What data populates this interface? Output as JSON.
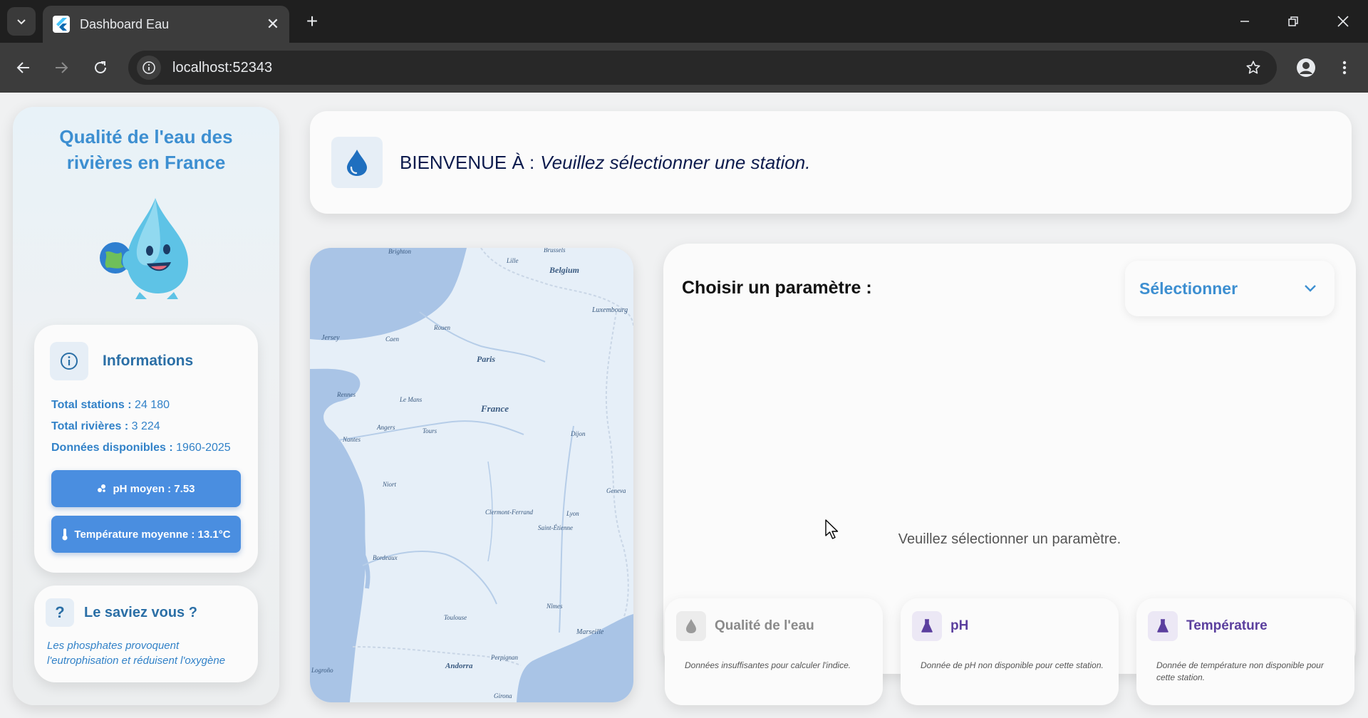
{
  "browser": {
    "tab_title": "Dashboard Eau",
    "url": "localhost:52343"
  },
  "sidebar": {
    "title": "Qualité de l'eau des rivières en France",
    "info": {
      "title": "Informations",
      "stats": [
        {
          "label": "Total stations :",
          "value": "24 180"
        },
        {
          "label": "Total rivières :",
          "value": "3 224"
        },
        {
          "label": "Données disponibles :",
          "value": "1960-2025"
        }
      ],
      "ph_button": "pH moyen : 7.53",
      "temp_button": "Température moyenne : 13.1°C"
    },
    "fact": {
      "title": "Le saviez vous ?",
      "text": "Les phosphates provoquent l'eutrophisation et réduisent l'oxygène"
    }
  },
  "banner": {
    "label": "BIENVENUE À :",
    "value": "Veuillez sélectionner une station."
  },
  "map": {
    "places": [
      {
        "name": "Brighton"
      },
      {
        "name": "Brussels"
      },
      {
        "name": "Lille"
      },
      {
        "name": "Belgium"
      },
      {
        "name": "Luxembourg"
      },
      {
        "name": "Jersey"
      },
      {
        "name": "Caen"
      },
      {
        "name": "Rouen"
      },
      {
        "name": "Paris"
      },
      {
        "name": "Rennes"
      },
      {
        "name": "Le Mans"
      },
      {
        "name": "France"
      },
      {
        "name": "Angers"
      },
      {
        "name": "Tours"
      },
      {
        "name": "Dijon"
      },
      {
        "name": "Nantes"
      },
      {
        "name": "Niort"
      },
      {
        "name": "Geneva"
      },
      {
        "name": "Clermont-Ferrand"
      },
      {
        "name": "Lyon"
      },
      {
        "name": "Saint-Étienne"
      },
      {
        "name": "Bordeaux"
      },
      {
        "name": "Nîmes"
      },
      {
        "name": "Toulouse"
      },
      {
        "name": "Marseille"
      },
      {
        "name": "Perpignan"
      },
      {
        "name": "Andorra"
      },
      {
        "name": "Logroño"
      },
      {
        "name": "Girona"
      }
    ]
  },
  "param_panel": {
    "label": "Choisir un paramètre :",
    "select_value": "Sélectionner",
    "message": "Veuillez sélectionner un paramètre."
  },
  "cards": [
    {
      "title": "Qualité de l'eau",
      "text": "Données insuffisantes pour calculer l'indice.",
      "color": "#8a8a8a",
      "icon": "water-drop-icon"
    },
    {
      "title": "pH",
      "text": "Donnée de pH non disponible pour cette station.",
      "color": "#5b3f9e",
      "icon": "flask-icon"
    },
    {
      "title": "Température",
      "text": "Donnée de température non disponible pour cette station.",
      "color": "#5b3f9e",
      "icon": "flask-icon"
    }
  ],
  "colors": {
    "accent": "#3d8fd1",
    "button": "#4a8ee0",
    "navy": "#0d1b4d",
    "purple": "#5b3f9e"
  }
}
